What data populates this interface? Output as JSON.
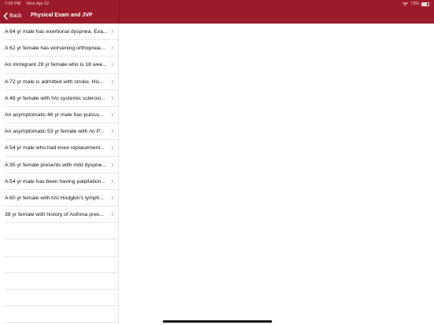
{
  "status": {
    "time": "7:53 PM",
    "date": "Mon Apr 22",
    "battery_text": "73%",
    "battery_level": 0.73
  },
  "nav": {
    "back_label": "Back",
    "title": "Physical Exam and JVP"
  },
  "items": [
    "A 64 yr male has exertional dyspnea. Exa...",
    "A 62 yr female has worsening orthopnea...",
    "An immigrant 28 yr female who is 18 wee...",
    "A 72 yr male is admitted with stroke. His...",
    "A 48 yr female with h/o systemic sclerosi...",
    "An asymptomatic 46 yr male has pulsus...",
    "An asymptomatic 53 yr female with no P...",
    "A 54 yr male who had knee replacement...",
    "A 35 yr female presents with mild dyspne...",
    "A 54 yr male has been having palpitation...",
    "A 60 yr female with h/o Hodgkin's lymph...",
    "38 yr female with history of Asthma pres..."
  ],
  "colors": {
    "accent": "#9c1b2a",
    "divider": "#e6e6e6"
  },
  "icons": {
    "back": "chevron-left-icon",
    "row": "chevron-right-icon",
    "wifi": "wifi-icon",
    "battery": "battery-icon"
  }
}
